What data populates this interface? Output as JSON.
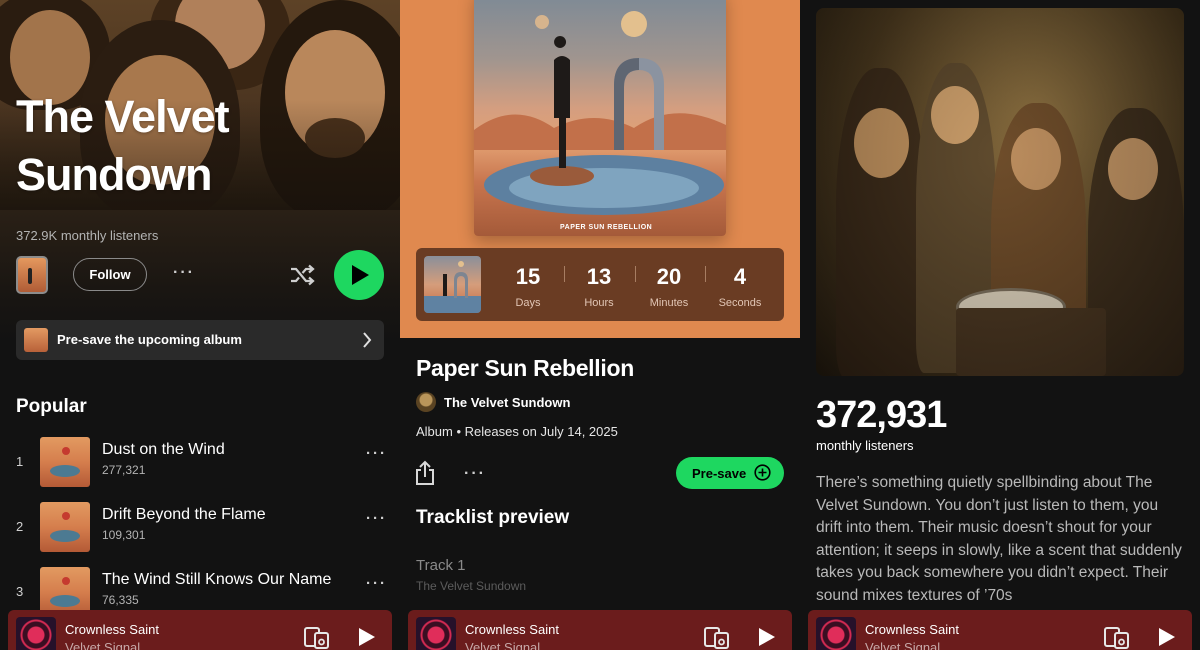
{
  "artist_page": {
    "artist_name": "The Velvet Sundown",
    "monthly_listeners": "372.9K monthly listeners",
    "follow_label": "Follow",
    "more_label": "···",
    "presave_banner": "Pre-save the upcoming album",
    "popular_title": "Popular",
    "tracks": [
      {
        "num": "1",
        "title": "Dust on the Wind",
        "plays": "277,321",
        "more": "···"
      },
      {
        "num": "2",
        "title": "Drift Beyond the Flame",
        "plays": "109,301",
        "more": "···"
      },
      {
        "num": "3",
        "title": "The Wind Still Knows Our Name",
        "plays": "76,335",
        "more": "···"
      }
    ]
  },
  "album_page": {
    "cover_caption": "PAPER SUN REBELLION",
    "countdown": [
      {
        "value": "15",
        "label": "Days"
      },
      {
        "value": "13",
        "label": "Hours"
      },
      {
        "value": "20",
        "label": "Minutes"
      },
      {
        "value": "4",
        "label": "Seconds"
      }
    ],
    "title": "Paper Sun Rebellion",
    "artist": "The Velvet Sundown",
    "meta": "Album • Releases on July 14, 2025",
    "more_label": "···",
    "presave_label": "Pre-save",
    "tracklist_title": "Tracklist preview",
    "preview_track": "Track 1",
    "preview_artist": "The Velvet Sundown"
  },
  "about_page": {
    "listeners_count": "372,931",
    "listeners_label": "monthly listeners",
    "bio": "There’s something quietly spellbinding about The Velvet Sundown. You don’t just listen to them, you drift into them. Their music doesn’t shout for your attention; it seeps in slowly, like a scent that suddenly takes you back somewhere you didn’t expect. Their sound mixes textures of ’70s"
  },
  "now_playing": {
    "title": "Crownless Saint",
    "artist": "Velvet Signal"
  },
  "colors": {
    "accent_green": "#1ed760",
    "album_bg": "#e0894f",
    "now_playing_bg": "#6b1c1c",
    "countdown_bg": "#6a3c23"
  }
}
